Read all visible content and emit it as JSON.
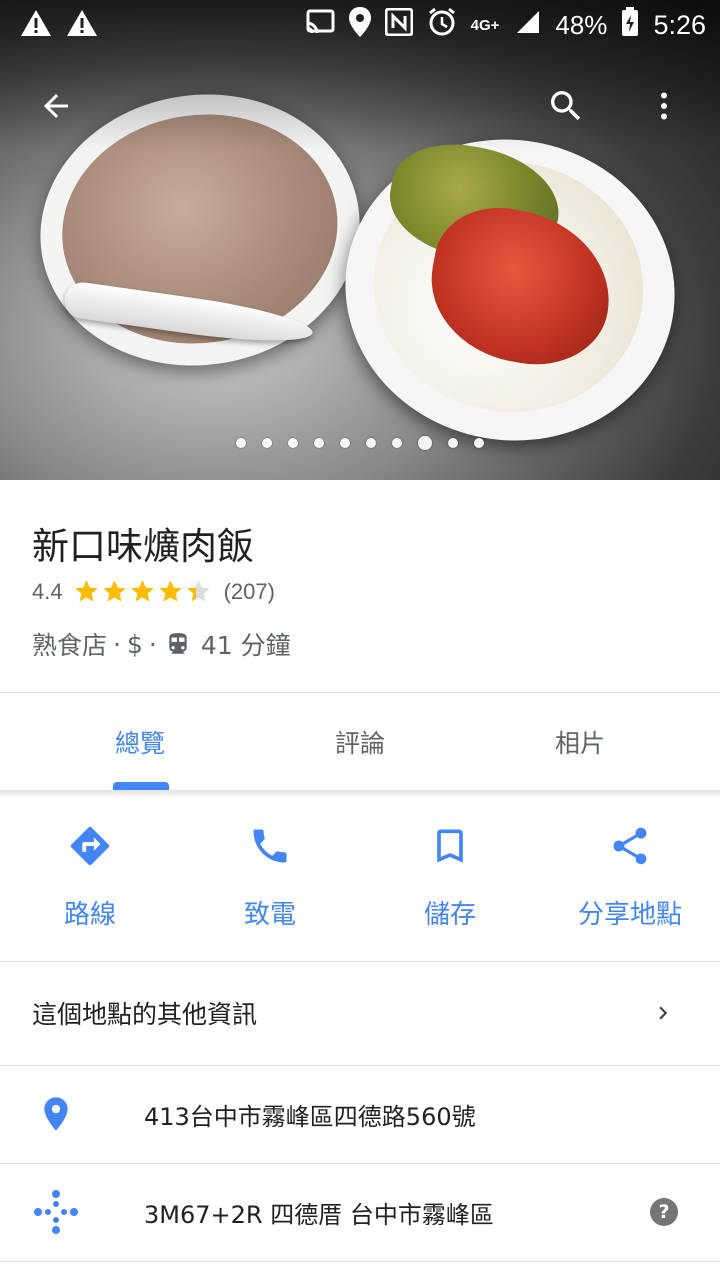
{
  "status_bar": {
    "battery_percent": "48%",
    "time": "5:26",
    "network": "4G+",
    "icons": [
      "warning-icon",
      "warning-icon",
      "cast-icon",
      "location-icon",
      "nfc-icon",
      "alarm-icon",
      "signal-icon",
      "battery-icon"
    ]
  },
  "hero": {
    "photo_count": 10,
    "active_photo_index": 7
  },
  "place": {
    "name": "新口味爌肉飯",
    "rating": "4.4",
    "rating_value": 4.4,
    "review_count": "(207)",
    "category": "熟食店",
    "price": "$",
    "transit_time": "41 分鐘"
  },
  "tabs": [
    {
      "label": "總覽",
      "active": true
    },
    {
      "label": "評論",
      "active": false
    },
    {
      "label": "相片",
      "active": false
    }
  ],
  "actions": [
    {
      "label": "路線",
      "icon": "directions-icon"
    },
    {
      "label": "致電",
      "icon": "phone-icon"
    },
    {
      "label": "儲存",
      "icon": "bookmark-icon"
    },
    {
      "label": "分享地點",
      "icon": "share-icon"
    }
  ],
  "more_info": {
    "label": "這個地點的其他資訊"
  },
  "address": {
    "text": "413台中市霧峰區四德路560號"
  },
  "plus_code": {
    "text": "3M67+2R 四德厝 台中市霧峰區"
  },
  "colors": {
    "accent": "#4285f4",
    "star": "#fbbc04",
    "secondary_text": "#5f6368",
    "primary_text": "#212121"
  }
}
